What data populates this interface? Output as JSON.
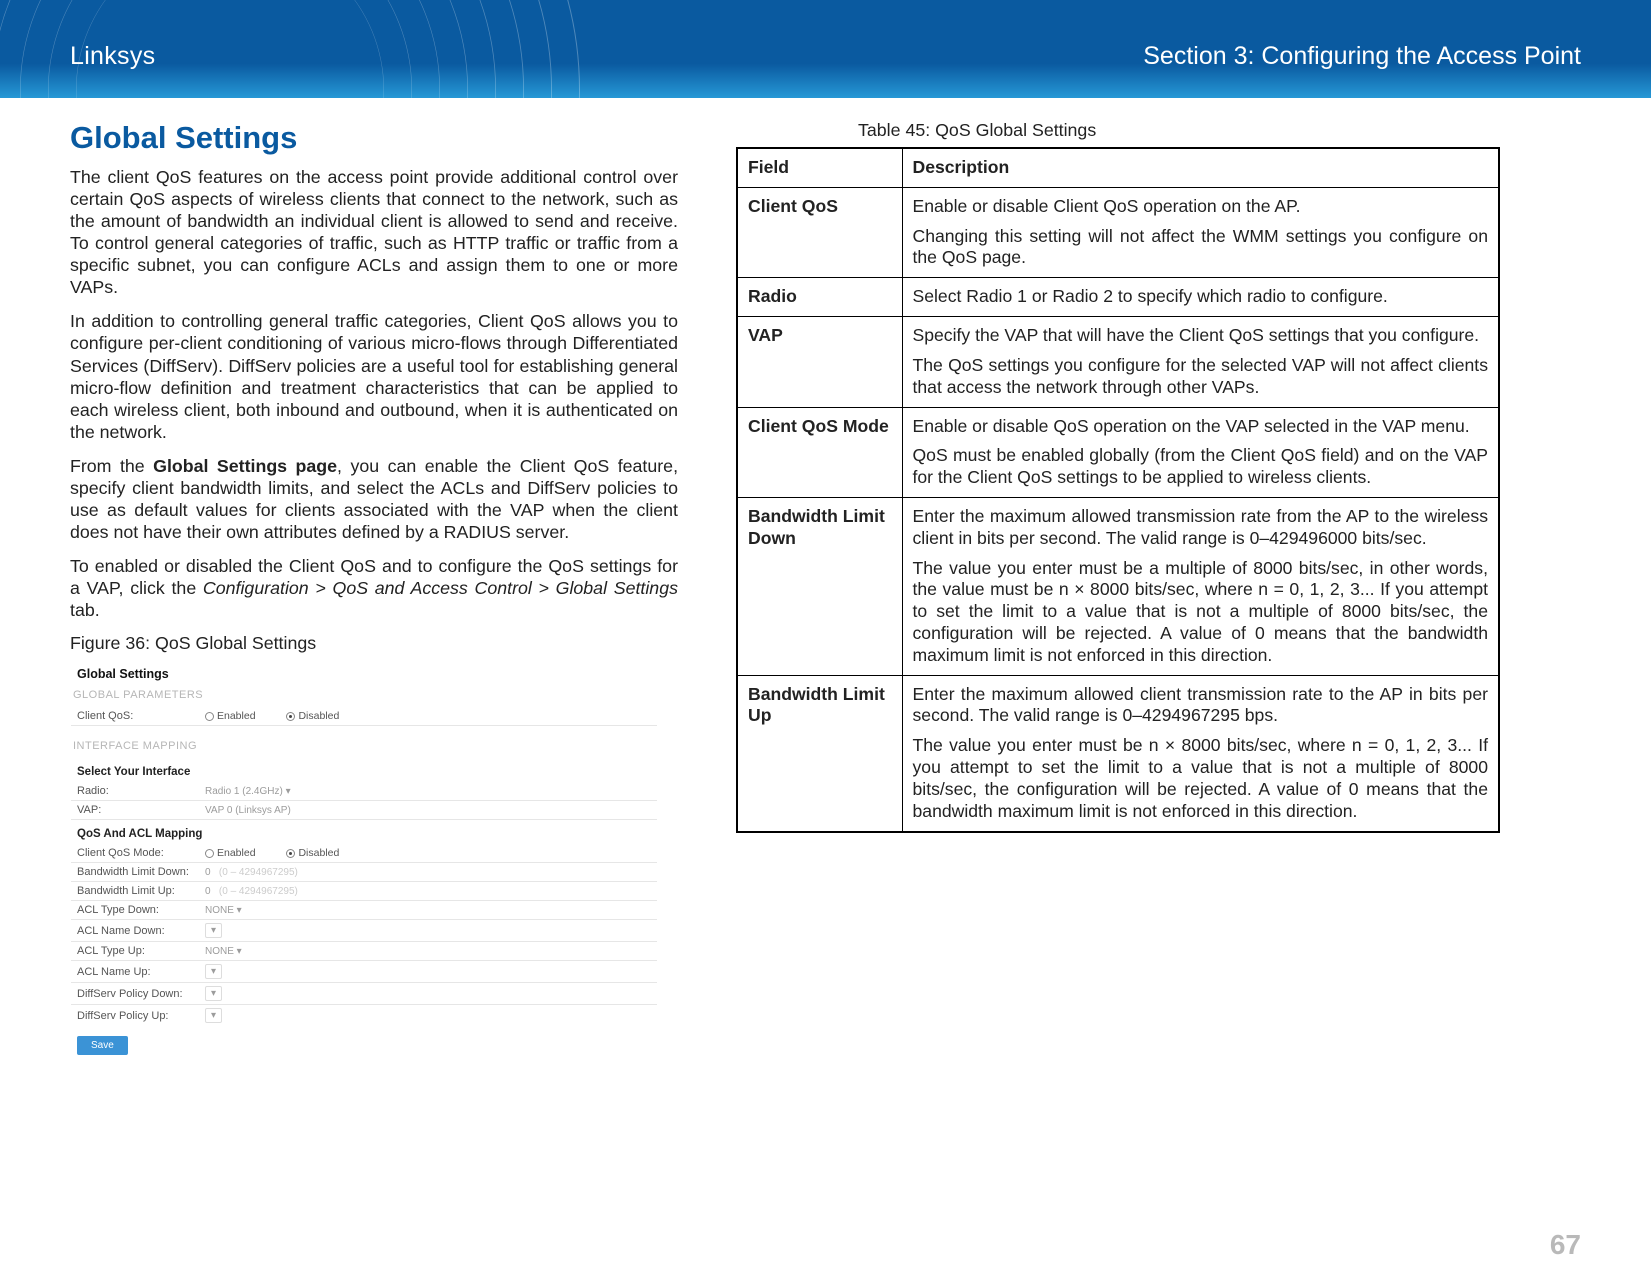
{
  "banner": {
    "brand": "Linksys",
    "section": "Section 3:  Configuring the Access Point"
  },
  "left": {
    "title": "Global Settings",
    "para1": "The client QoS features on the access point provide additional control over certain QoS aspects of wireless clients that connect to the network, such as the amount of bandwidth an individual client is allowed to send and receive. To control general categories of traffic, such as HTTP traffic or traffic from a specific subnet, you can configure ACLs and assign them to one or more VAPs.",
    "para2": "In addition to controlling general traffic categories, Client QoS allows you to configure per-client conditioning of various micro-flows through Differentiated Services (DiffServ). DiffServ policies are a useful tool for establishing general micro-flow definition and treatment characteristics that can be applied to each wireless client, both inbound and outbound, when it is authenticated on the network.",
    "para3_pre": "From the ",
    "para3_bold": "Global Settings page",
    "para3_post": ", you can enable the Client QoS feature, specify client bandwidth limits, and select the ACLs and DiffServ policies to use as default values for clients associated with the VAP when the client does not have their own attributes defined by a RADIUS server.",
    "para4_pre": "To enabled or disabled the Client QoS and to configure the QoS settings for a VAP, click the ",
    "para4_italic": "Configuration > QoS and Access Control > Global Settings",
    "para4_post": " tab.",
    "figure_caption": "Figure 36: QoS Global Settings"
  },
  "mock": {
    "title": "Global Settings",
    "sec_global": "GLOBAL PARAMETERS",
    "row_clientqos": "Client QoS:",
    "opt_enabled": "Enabled",
    "opt_disabled": "Disabled",
    "sec_interface": "INTERFACE MAPPING",
    "select_iface": "Select Your Interface",
    "row_radio": "Radio:",
    "row_radio_val": "Radio 1 (2.4GHz)  ▾",
    "row_vap": "VAP:",
    "row_vap_val": "VAP 0 (Linksys AP)",
    "qos_acl_map": "QoS And ACL Mapping",
    "row_clientqosmode": "Client QoS Mode:",
    "row_bw_down": "Bandwidth Limit Down:",
    "bw_down_val": "0",
    "bw_down_hint": "(0 – 4294967295)",
    "row_bw_up": "Bandwidth Limit Up:",
    "bw_up_val": "0",
    "bw_up_hint": "(0 – 4294967295)",
    "row_acl_type_down": "ACL Type Down:",
    "none": "NONE  ▾",
    "row_acl_name_down": "ACL Name Down:",
    "row_acl_type_up": "ACL Type Up:",
    "row_acl_name_up": "ACL Name Up:",
    "row_diff_down": "DiffServ Policy Down:",
    "row_diff_up": "DiffServ Policy Up:",
    "save": "Save"
  },
  "right": {
    "table_caption": "Table 45: QoS Global Settings",
    "th_field": "Field",
    "th_desc": "Description",
    "rows": {
      "r0": {
        "field": "Client QoS",
        "d1": "Enable or disable Client QoS operation on the AP.",
        "d2": "Changing this setting will not affect the WMM settings you configure on the QoS page."
      },
      "r1": {
        "field": "Radio",
        "d1": "Select Radio 1 or Radio 2 to specify which radio to configure."
      },
      "r2": {
        "field": "VAP",
        "d1": "Specify the VAP that will have the Client QoS settings that you configure.",
        "d2": "The QoS settings you configure for the selected VAP will not affect clients that access the network through other VAPs."
      },
      "r3": {
        "field": "Client QoS Mode",
        "d1": "Enable or disable QoS operation on the VAP selected in the VAP menu.",
        "d2": "QoS must be enabled globally (from the Client QoS field) and on the VAP for the Client QoS settings to be applied to wireless clients."
      },
      "r4": {
        "field": "Bandwidth Limit Down",
        "d1": "Enter the maximum allowed transmission rate from the AP to the wireless client in bits per second. The valid range is 0–429496000 bits/sec.",
        "d2": "The value you enter must be a multiple of 8000 bits/sec, in other words, the value must be n × 8000 bits/sec, where n = 0, 1, 2, 3... If you attempt to set the limit to a value that is not a multiple of 8000 bits/sec, the configuration will be rejected. A value of 0 means that the bandwidth maximum limit is not enforced in this direction."
      },
      "r5": {
        "field": "Bandwidth Limit Up",
        "d1": "Enter the maximum allowed client transmission rate to the AP in bits per second. The valid range is 0–4294967295 bps.",
        "d2": "The value you enter must be n × 8000 bits/sec, where n = 0, 1, 2, 3... If you attempt to set the limit to a value that is not a multiple of 8000 bits/sec, the configuration will be rejected. A value of 0 means that the bandwidth maximum limit is not enforced in this direction."
      }
    }
  },
  "page_number": "67"
}
